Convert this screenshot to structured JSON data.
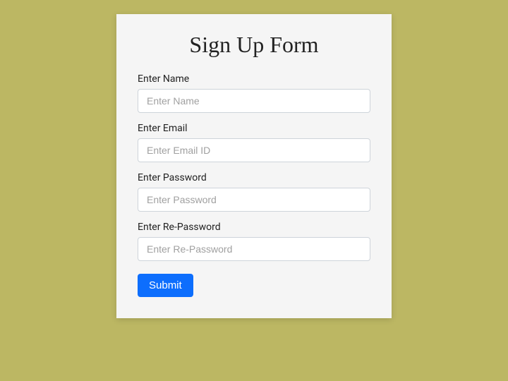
{
  "form": {
    "title": "Sign Up Form",
    "fields": [
      {
        "label": "Enter Name",
        "placeholder": "Enter Name"
      },
      {
        "label": "Enter Email",
        "placeholder": "Enter Email ID"
      },
      {
        "label": "Enter Password",
        "placeholder": "Enter Password"
      },
      {
        "label": "Enter Re-Password",
        "placeholder": "Enter Re-Password"
      }
    ],
    "submit_label": "Submit"
  }
}
